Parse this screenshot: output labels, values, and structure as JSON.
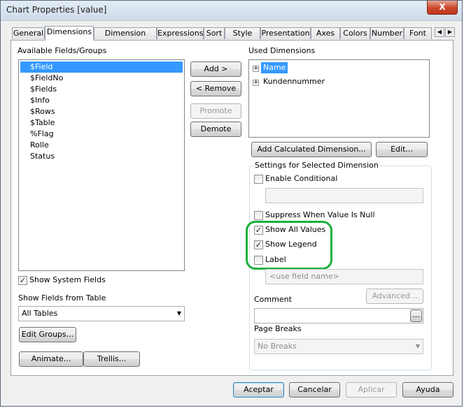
{
  "window": {
    "title": "Chart Properties [value]",
    "close_glyph": "X"
  },
  "tabs": [
    {
      "label": "General"
    },
    {
      "label": "Dimensions"
    },
    {
      "label": "Dimension Limits"
    },
    {
      "label": "Expressions"
    },
    {
      "label": "Sort"
    },
    {
      "label": "Style"
    },
    {
      "label": "Presentation"
    },
    {
      "label": "Axes"
    },
    {
      "label": "Colors"
    },
    {
      "label": "Number"
    },
    {
      "label": "Font"
    }
  ],
  "tab_scroll": {
    "left": "◀",
    "right": "▶"
  },
  "available": {
    "label": "Available Fields/Groups",
    "items": [
      "$Field",
      "$FieldNo",
      "$Fields",
      "$Info",
      "$Rows",
      "$Table",
      "%Flag",
      "Rolle",
      "Status"
    ]
  },
  "buttons": {
    "add": "Add >",
    "remove": "< Remove",
    "promote": "Promote",
    "demote": "Demote",
    "add_calc": "Add Calculated Dimension...",
    "edit": "Edit...",
    "edit_groups": "Edit Groups...",
    "animate": "Animate...",
    "trellis": "Trellis...",
    "advanced": "Advanced...",
    "comment_more": "..."
  },
  "used": {
    "label": "Used Dimensions",
    "items": [
      "Name",
      "Kundennummer"
    ],
    "expand_glyph": "+"
  },
  "show_system_fields": {
    "label": "Show System Fields",
    "checked": true
  },
  "show_fields_from_table": {
    "label": "Show Fields from Table",
    "value": "All Tables"
  },
  "settings": {
    "group_label": "Settings for Selected Dimension",
    "enable_conditional": "Enable Conditional",
    "suppress_null": "Suppress When Value Is Null",
    "show_all_values": "Show All Values",
    "show_legend": "Show Legend",
    "label": "Label",
    "label_placeholder": "<use field name>",
    "comment": "Comment",
    "page_breaks": "Page Breaks",
    "page_breaks_value": "No Breaks"
  },
  "checks": {
    "on": "✓",
    "off": ""
  },
  "dropdown_arrow": "▼",
  "footer": {
    "ok": "Aceptar",
    "cancel": "Cancelar",
    "apply": "Aplicar",
    "help": "Ayuda"
  },
  "colors": {
    "selection": "#3399ff",
    "highlight": "#1bb03b"
  }
}
